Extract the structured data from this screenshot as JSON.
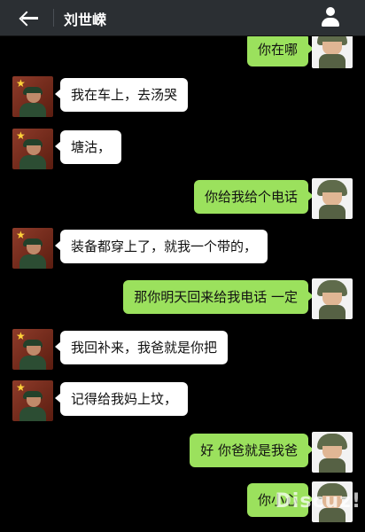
{
  "header": {
    "back_icon": "arrow-left-icon",
    "title": "刘世嵘",
    "profile_icon": "person-icon"
  },
  "messages": [
    {
      "side": "right",
      "text": "你在哪"
    },
    {
      "side": "left",
      "text": "我在车上，去汤哭"
    },
    {
      "side": "left",
      "text": "塘沽，"
    },
    {
      "side": "right",
      "text": "你给我给个电话"
    },
    {
      "side": "left",
      "text": "装备都穿上了，就我一个带的，"
    },
    {
      "side": "right",
      "text": "那你明天回来给我电话 一定"
    },
    {
      "side": "left",
      "text": "我回补来，我爸就是你把"
    },
    {
      "side": "left",
      "text": "记得给我妈上坟，"
    },
    {
      "side": "right",
      "text": "好 你爸就是我爸"
    },
    {
      "side": "right",
      "text": "你小心"
    }
  ],
  "watermark": "Discuz!",
  "colors": {
    "topbar": "#2b2f33",
    "background": "#000000",
    "bubble_left": "#ffffff",
    "bubble_right": "#9be15d"
  }
}
